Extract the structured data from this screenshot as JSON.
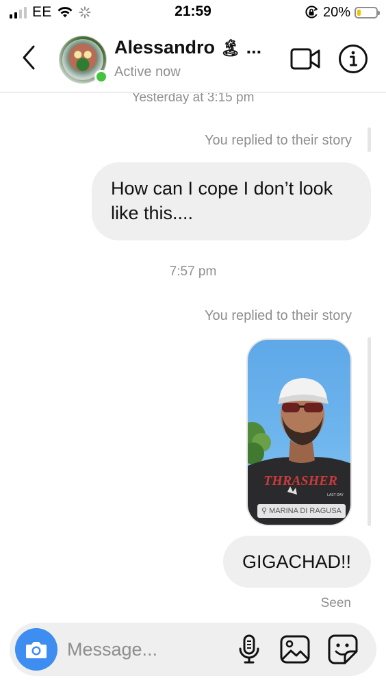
{
  "status_bar": {
    "carrier": "EE",
    "time": "21:59",
    "battery_percent": "20%",
    "battery_level": 0.2,
    "icons": [
      "signal-icon",
      "wifi-icon",
      "activity-spinner-icon",
      "orientation-lock-icon",
      "battery-icon"
    ]
  },
  "header": {
    "contact_name": "Alessandro",
    "name_emoji": "🏝",
    "name_ellipsis": "...",
    "status": "Active now",
    "icons": [
      "back-chevron-icon",
      "avatar",
      "video-call-icon",
      "info-icon"
    ]
  },
  "chat": {
    "timestamp_1": "Yesterday at 3:15 pm",
    "reply_label_1": "You replied to their story",
    "message_1": "How can I cope I don’t look like this....",
    "timestamp_2": "7:57 pm",
    "reply_label_2": "You replied to their story",
    "story": {
      "shirt_text": "THRASHER",
      "small_text": "LAST DAY",
      "location": "MARINA DI RAGUSA"
    },
    "message_2": "GIGACHAD!!",
    "seen": "Seen"
  },
  "composer": {
    "placeholder": "Message...",
    "icons": [
      "camera-icon",
      "microphone-icon",
      "gallery-icon",
      "sticker-icon"
    ]
  },
  "colors": {
    "online": "#44c33e",
    "camera_button": "#3d8ef0",
    "bubble": "#efefef",
    "muted_text": "#8e8e8e"
  }
}
